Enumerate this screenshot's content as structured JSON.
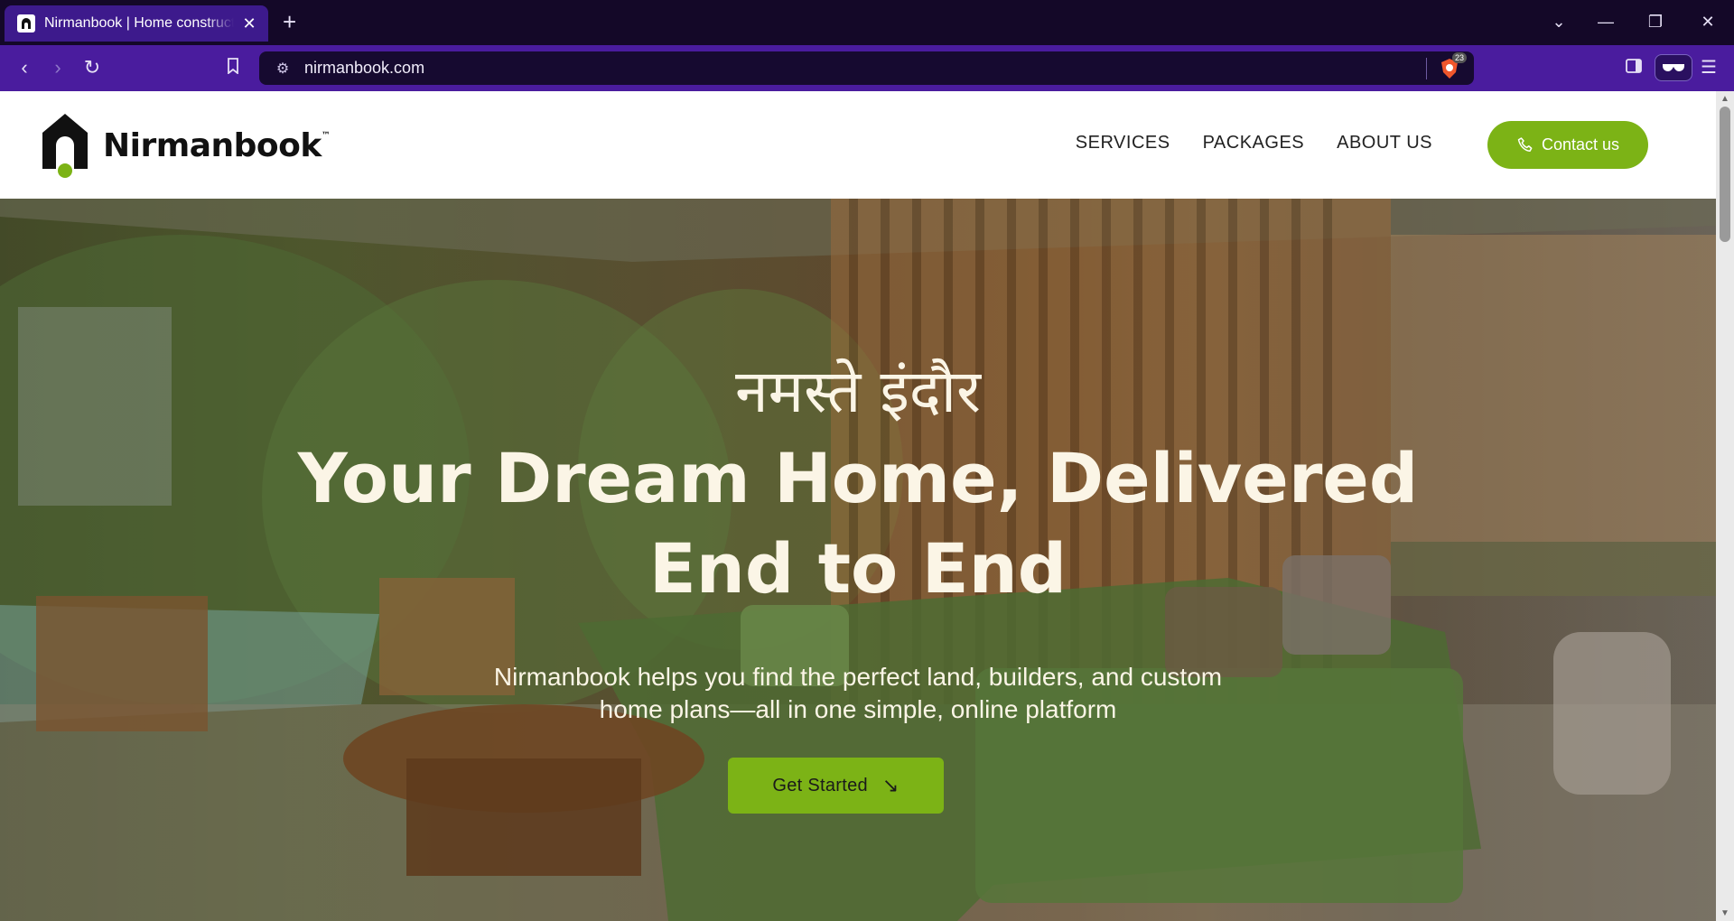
{
  "browser": {
    "tab_title": "Nirmanbook | Home construction",
    "url": "nirmanbook.com",
    "shield_count": "23"
  },
  "header": {
    "logo_text": "Nirmanbook",
    "logo_tm": "™",
    "nav": [
      "SERVICES",
      "PACKAGES",
      "ABOUT US"
    ],
    "contact_label": "Contact us"
  },
  "hero": {
    "greeting": "नमस्ते इंदौर",
    "title_line1": "Your Dream Home, Delivered",
    "title_line2": "End to End",
    "subtitle_line1": "Nirmanbook helps you find the perfect land, builders, and custom",
    "subtitle_line2": "home plans—all in one simple, online platform",
    "cta_label": "Get Started",
    "cta_arrow": "↘"
  },
  "colors": {
    "brand_green": "#7cb316",
    "browser_purple": "#4a1c9e"
  }
}
